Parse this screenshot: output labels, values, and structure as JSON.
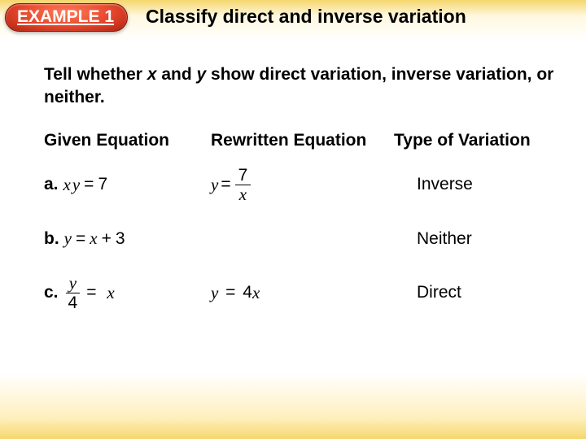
{
  "header": {
    "badge": "EXAMPLE 1",
    "title": "Classify direct and inverse variation"
  },
  "instruction": {
    "lead": "Tell whether ",
    "var1": "x",
    "mid1": " and ",
    "var2": "y",
    "mid2": " show ",
    "strong": "direct variation, inverse variation, or neither."
  },
  "columns": {
    "c1": "Given Equation",
    "c2": "Rewritten Equation",
    "c3": "Type of Variation"
  },
  "rows": [
    {
      "label": "a.",
      "given": {
        "lhs1": "x",
        "lhs2": "y",
        "op": "=",
        "rhs": "7"
      },
      "rewritten": {
        "lhs": "y",
        "op": "=",
        "num": "7",
        "den": "x"
      },
      "type": "Inverse"
    },
    {
      "label": "b.",
      "given": {
        "lhs": "y",
        "op": "=",
        "r1": "x",
        "plus": "+",
        "r2": "3"
      },
      "rewritten": null,
      "type": "Neither"
    },
    {
      "label": "c.",
      "given": {
        "num": "y",
        "den": "4",
        "op": "=",
        "rhs": "x"
      },
      "rewritten": {
        "lhs": "y",
        "op": "=",
        "coef": "4",
        "var": "x"
      },
      "type": "Direct"
    }
  ]
}
